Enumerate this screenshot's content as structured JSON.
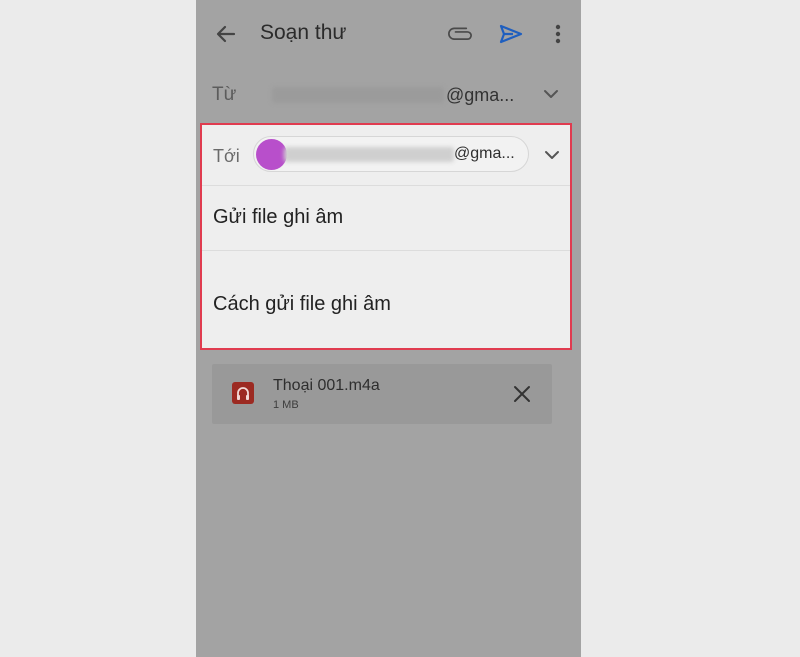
{
  "appbar": {
    "title": "Soạn thư",
    "back_icon": "arrow-left-icon",
    "attach_icon": "paperclip-icon",
    "send_icon": "send-icon",
    "more_icon": "more-vert-icon",
    "send_color": "#1f5fbf"
  },
  "from": {
    "label": "Từ",
    "value": "@gma..."
  },
  "to": {
    "label": "Tới",
    "value": "@gma...",
    "avatar_color": "#b84fcb"
  },
  "subject": {
    "text": "Gửi file ghi âm"
  },
  "body": {
    "text": "Cách gửi file ghi âm"
  },
  "attachment": {
    "name": "Thoại 001.m4a",
    "size": "1 MB",
    "icon": "audio-file-icon",
    "remove_icon": "close-icon"
  },
  "colors": {
    "highlight_border": "#e03b4f",
    "overlay": "#a3a3a3"
  }
}
